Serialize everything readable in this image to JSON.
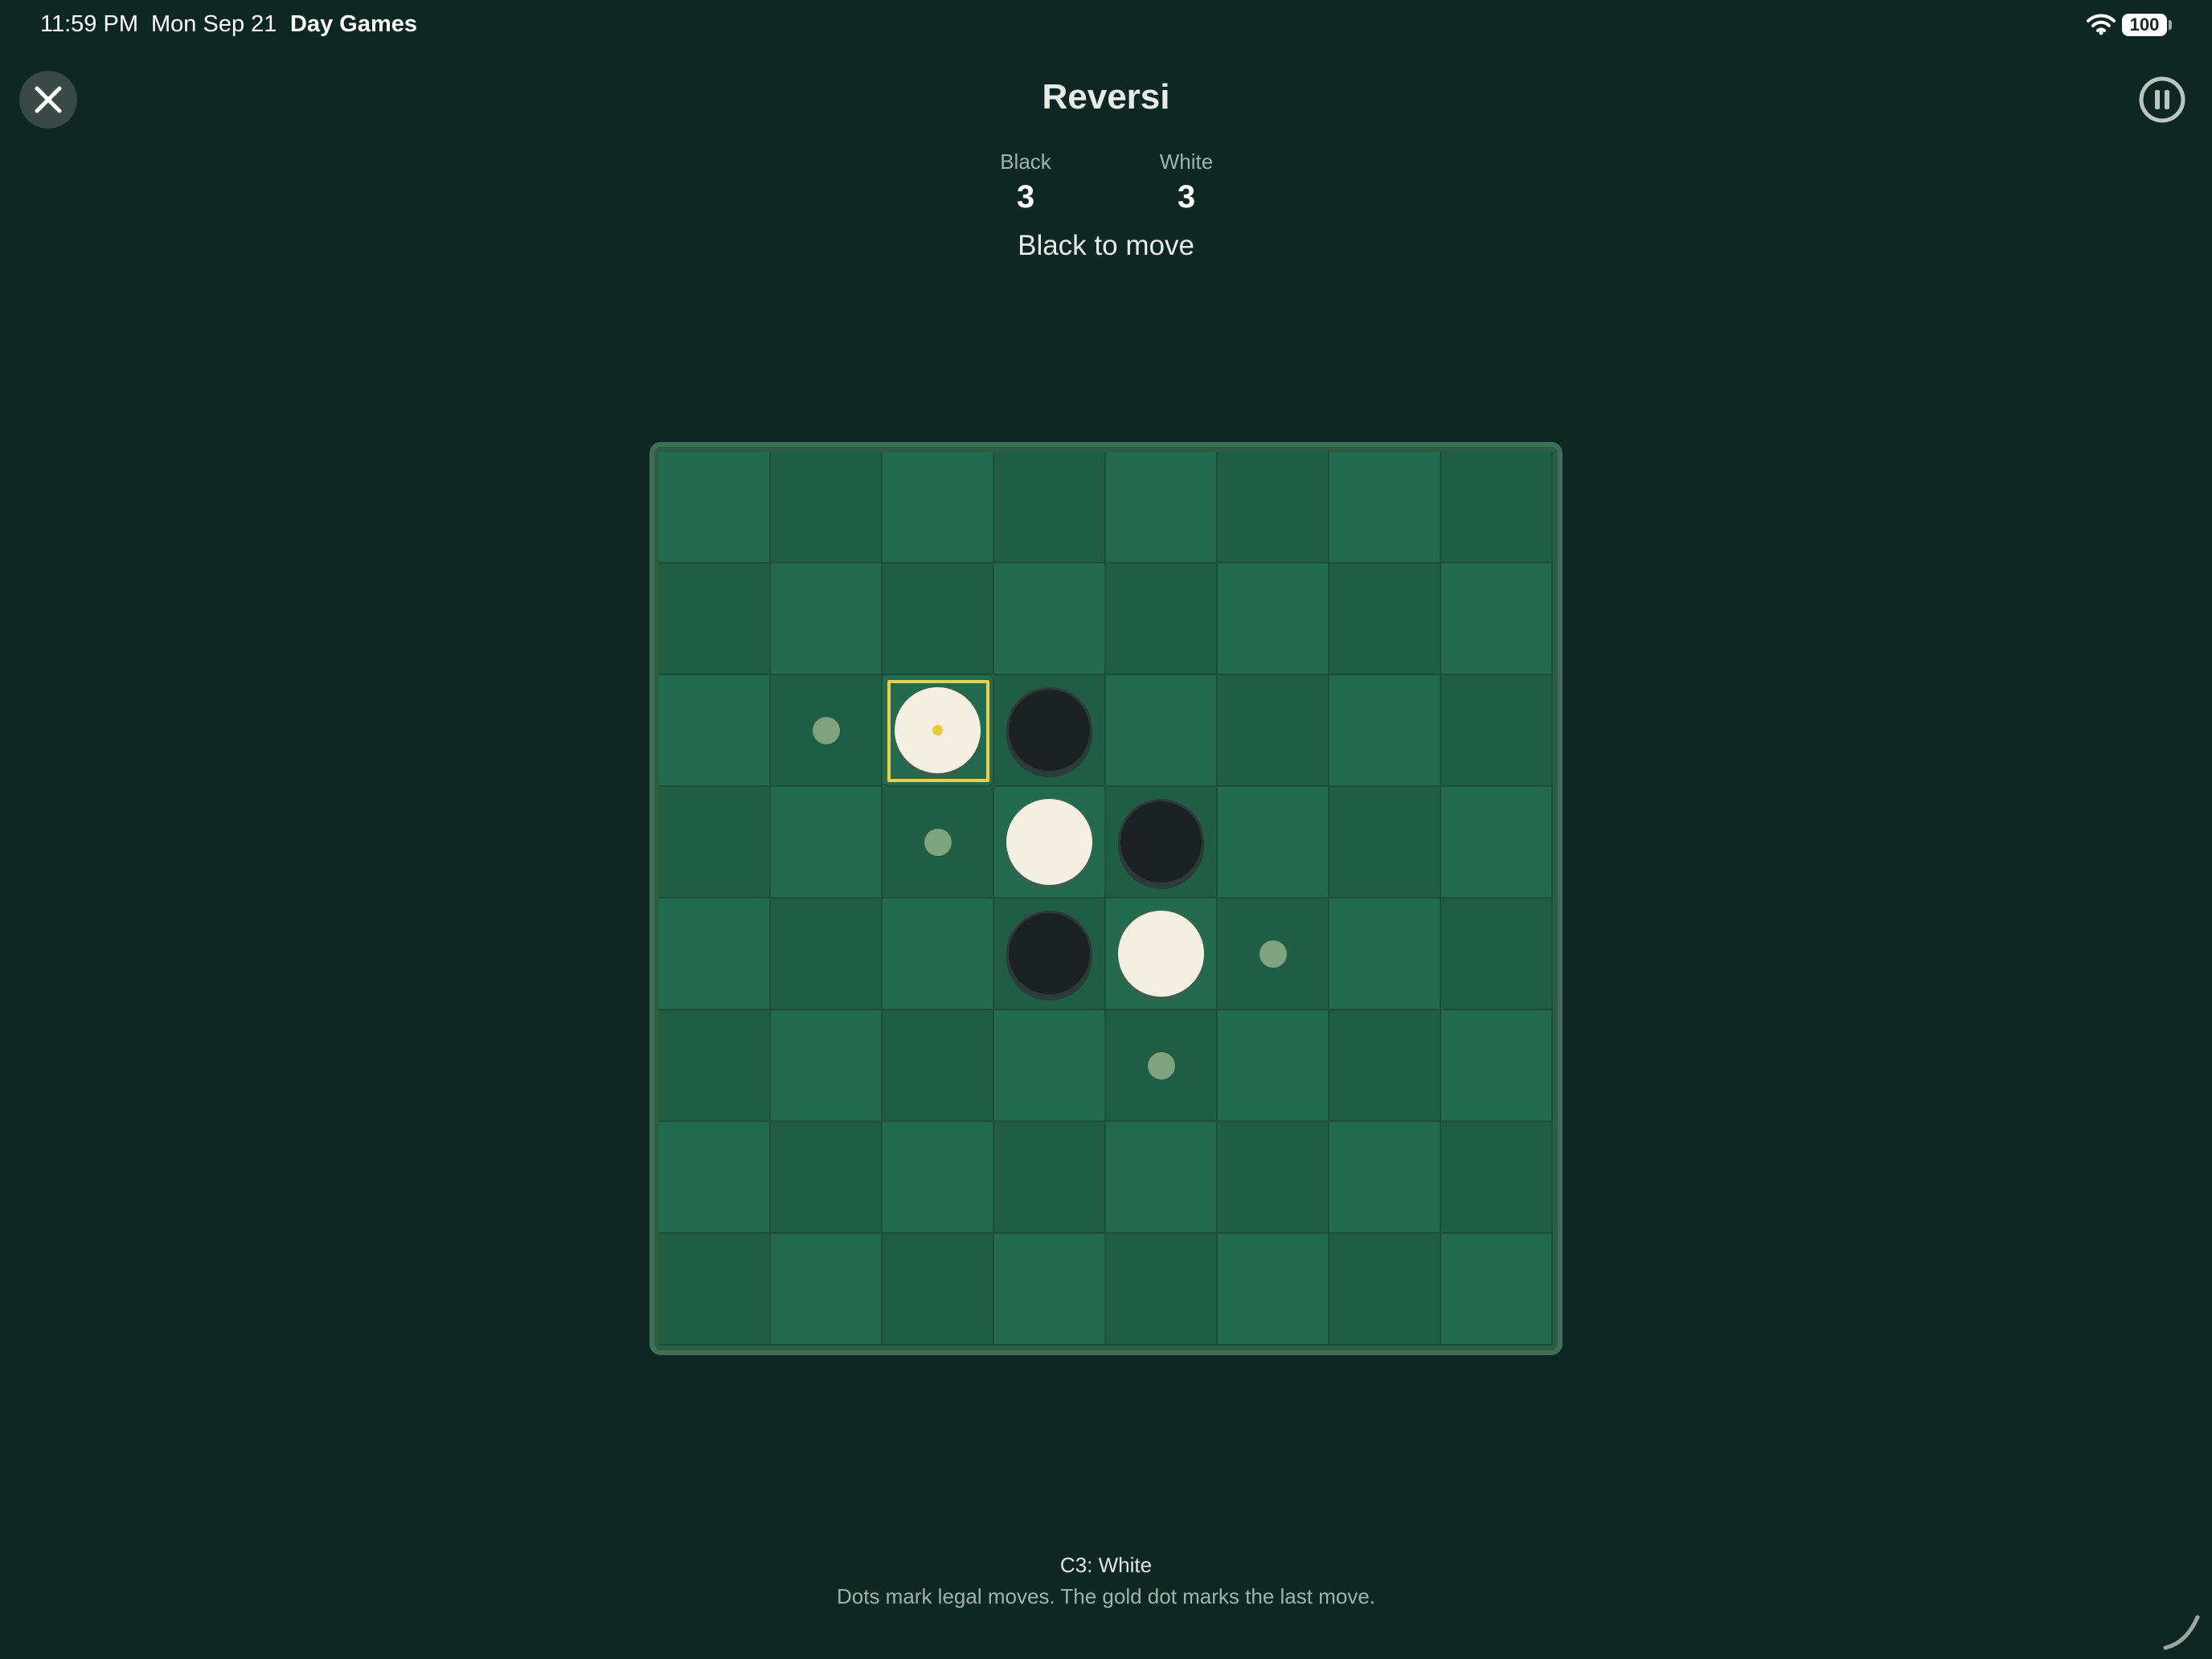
{
  "status_bar": {
    "time": "11:59 PM",
    "date": "Mon Sep 21",
    "app": "Day Games",
    "battery": "100",
    "wifi_icon": "wifi-icon"
  },
  "header": {
    "title": "Reversi",
    "close_icon": "close-icon",
    "pause_icon": "pause-icon"
  },
  "scores": {
    "black_label": "Black",
    "black_value": "3",
    "white_label": "White",
    "white_value": "3"
  },
  "turn": "Black to move",
  "board": {
    "size": 8,
    "colors": {
      "light": "#246a4e",
      "dark": "#1f5e45",
      "highlight": "#e9cf4c"
    },
    "pieces": [
      {
        "cell": "C3",
        "color": "white"
      },
      {
        "cell": "D3",
        "color": "black"
      },
      {
        "cell": "D4",
        "color": "white"
      },
      {
        "cell": "E4",
        "color": "black"
      },
      {
        "cell": "D5",
        "color": "black"
      },
      {
        "cell": "E5",
        "color": "white"
      }
    ],
    "legal_moves": [
      "B3",
      "C4",
      "F5",
      "E6"
    ],
    "last_move": "C3"
  },
  "footer": {
    "last_move_text": "C3: White",
    "hint": "Dots mark legal moves. The gold dot marks the last move."
  }
}
